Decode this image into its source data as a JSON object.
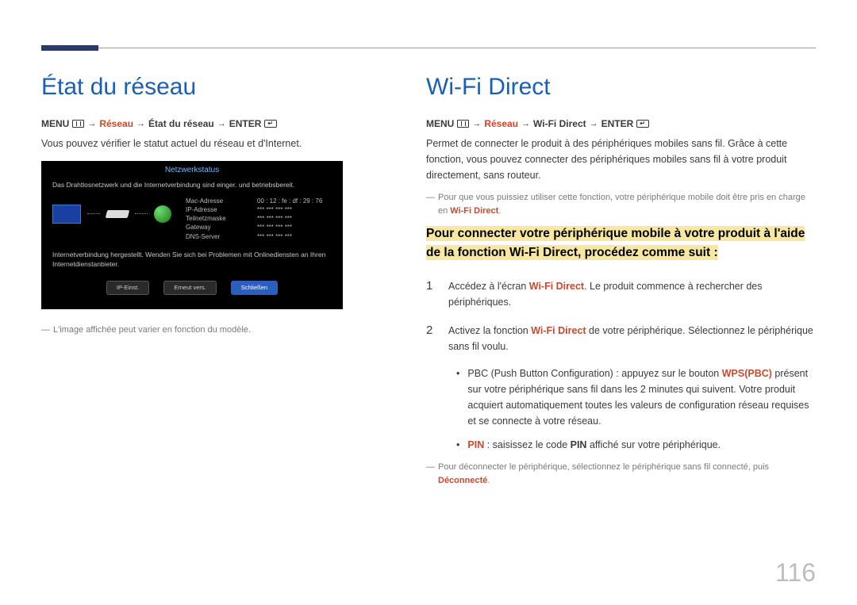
{
  "page_number": "116",
  "left": {
    "heading": "État du réseau",
    "menu": {
      "label_menu": "MENU",
      "seg1": "Réseau",
      "seg2": "État du réseau",
      "label_enter": "ENTER"
    },
    "desc": "Vous pouvez vérifier le statut actuel du réseau et d'Internet.",
    "screenshot": {
      "title": "Netzwerkstatus",
      "line1": "Das Drahtlosnetzwerk und die Internetverbindung sind einger. und betriebsbereit.",
      "table": {
        "r1a": "Mac-Adresse",
        "r1b": "00 : 12 : fe : df : 29 : 76",
        "r2a": "IP-Adresse",
        "r2b": "***  ***  ***  ***",
        "r3a": "Teilnetzmaske",
        "r3b": "***  ***  ***  ***",
        "r4a": "Gateway",
        "r4b": "***  ***  ***  ***",
        "r5a": "DNS-Server",
        "r5b": "***  ***  ***  ***"
      },
      "line2": "Internetverbindung hergestellt. Wenden Sie sich bei Problemen mit Onlinediensten an Ihren Internetdienstanbieter.",
      "btn1": "IP-Einst.",
      "btn2": "Erneut vers.",
      "btn3": "Schließen"
    },
    "note": "L'image affichée peut varier en fonction du modèle."
  },
  "right": {
    "heading": "Wi-Fi Direct",
    "menu": {
      "label_menu": "MENU",
      "seg1": "Réseau",
      "seg2": "Wi-Fi Direct",
      "label_enter": "ENTER"
    },
    "desc": "Permet de connecter le produit à des périphériques mobiles sans fil. Grâce à cette fonction, vous pouvez connecter des périphériques mobiles sans fil à votre produit directement, sans routeur.",
    "note1_a": "Pour que vous puissiez utiliser cette fonction, votre périphérique mobile doit être pris en charge en ",
    "note1_b": "Wi-Fi Direct",
    "highlight": "Pour connecter votre périphérique mobile à votre produit à l'aide de la fonction Wi-Fi Direct, procédez comme suit :",
    "step1_a": "Accédez à l'écran ",
    "step1_b": "Wi-Fi Direct",
    "step1_c": ". Le produit commence à rechercher des périphériques.",
    "step2_a": "Activez la fonction ",
    "step2_b": "Wi-Fi Direct",
    "step2_c": " de votre périphérique. Sélectionnez le périphérique sans fil voulu.",
    "bullet1_a": "PBC (Push Button Configuration) : appuyez sur le bouton ",
    "bullet1_b": "WPS(PBC)",
    "bullet1_c": " présent sur votre périphérique sans fil dans les 2 minutes qui suivent. Votre produit acquiert automatiquement toutes les valeurs de configuration réseau requises et se connecte à votre réseau.",
    "bullet2_a": "PIN",
    "bullet2_b": " : saisissez le code ",
    "bullet2_c": "PIN",
    "bullet2_d": " affiché sur votre périphérique.",
    "note2_a": "Pour déconnecter le périphérique, sélectionnez le périphérique sans fil connecté, puis ",
    "note2_b": "Déconnecté"
  }
}
